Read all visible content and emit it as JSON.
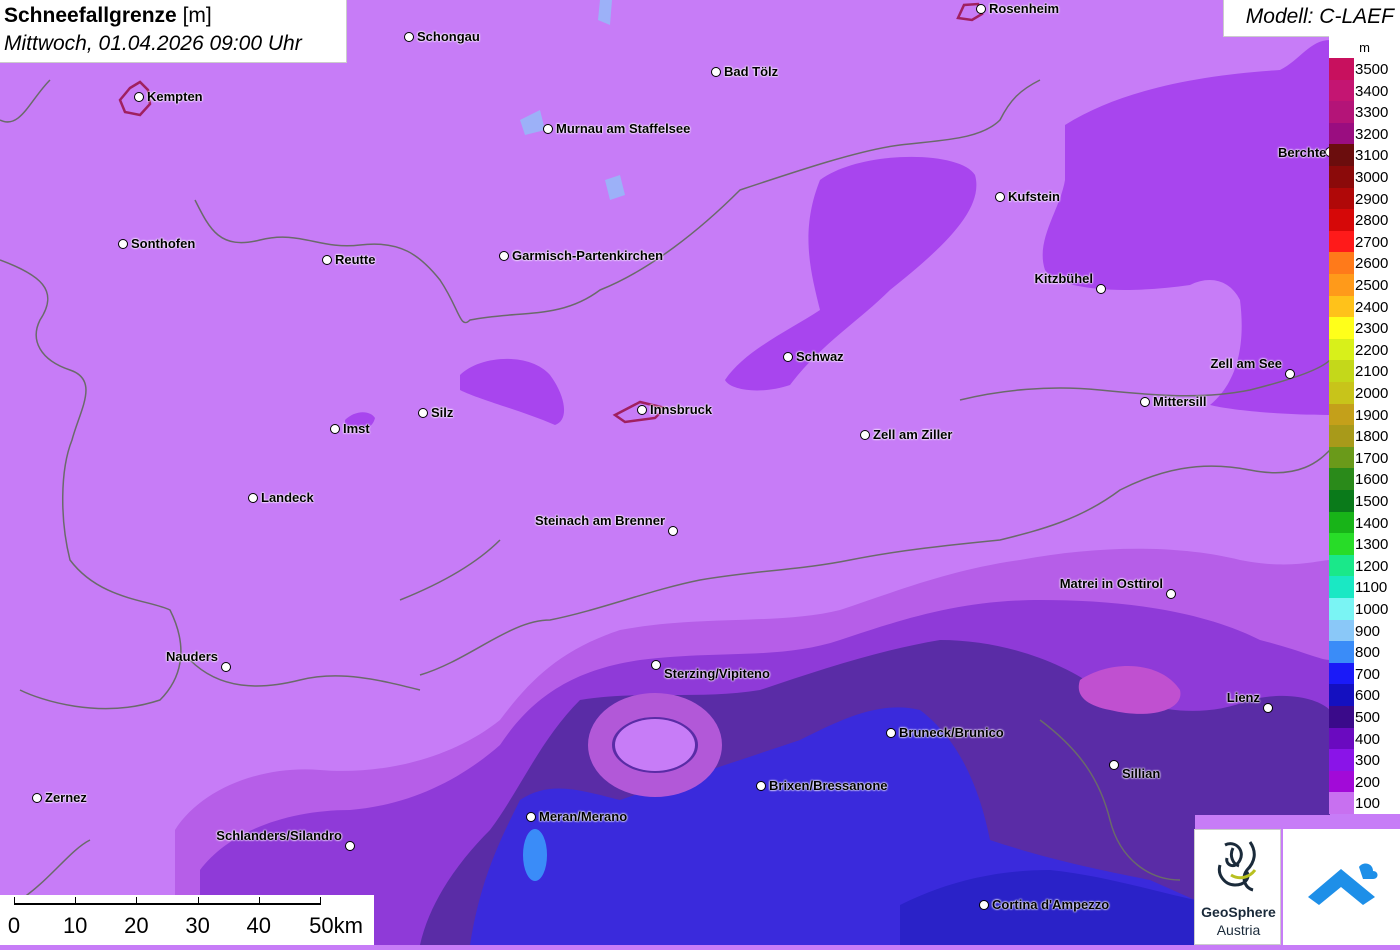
{
  "title": {
    "main": "Schneefallgrenze",
    "unit": "[m]",
    "date": "Mittwoch, 01.04.2026 09:00 Uhr"
  },
  "model_label": "Modell: C-LAEF",
  "legend": {
    "unit": "m",
    "levels": [
      {
        "value": "3500",
        "color": "#c8105e"
      },
      {
        "value": "3400",
        "color": "#c41572"
      },
      {
        "value": "3300",
        "color": "#b41478"
      },
      {
        "value": "3200",
        "color": "#9a0d80"
      },
      {
        "value": "3100",
        "color": "#6b0d0d"
      },
      {
        "value": "3000",
        "color": "#8b0a0a"
      },
      {
        "value": "2900",
        "color": "#b00808"
      },
      {
        "value": "2800",
        "color": "#d60808"
      },
      {
        "value": "2700",
        "color": "#ff1a1a"
      },
      {
        "value": "2600",
        "color": "#ff7a1a"
      },
      {
        "value": "2500",
        "color": "#ff9a1a"
      },
      {
        "value": "2400",
        "color": "#ffc21a"
      },
      {
        "value": "2300",
        "color": "#ffff1a"
      },
      {
        "value": "2200",
        "color": "#d8f01a"
      },
      {
        "value": "2100",
        "color": "#c4d81a"
      },
      {
        "value": "2000",
        "color": "#c8c41a"
      },
      {
        "value": "1900",
        "color": "#c4a01a"
      },
      {
        "value": "1800",
        "color": "#a89a1a"
      },
      {
        "value": "1700",
        "color": "#6a9a1a"
      },
      {
        "value": "1600",
        "color": "#2a8a1a"
      },
      {
        "value": "1500",
        "color": "#0a7a1a"
      },
      {
        "value": "1400",
        "color": "#18b418"
      },
      {
        "value": "1300",
        "color": "#28dc28"
      },
      {
        "value": "1200",
        "color": "#1ae88a"
      },
      {
        "value": "1100",
        "color": "#1ae8c4"
      },
      {
        "value": "1000",
        "color": "#7af4f4"
      },
      {
        "value": "900",
        "color": "#8ac8f8"
      },
      {
        "value": "800",
        "color": "#3a8cf8"
      },
      {
        "value": "700",
        "color": "#1a1af8"
      },
      {
        "value": "600",
        "color": "#1410c0"
      },
      {
        "value": "500",
        "color": "#3a0a8a"
      },
      {
        "value": "400",
        "color": "#6a0ac0"
      },
      {
        "value": "300",
        "color": "#8a14e8"
      },
      {
        "value": "200",
        "color": "#a20ad8"
      },
      {
        "value": "100",
        "color": "#c870f0"
      }
    ]
  },
  "scale_bar": {
    "labels": [
      "0",
      "10",
      "20",
      "30",
      "40",
      "50km"
    ]
  },
  "logos": {
    "geosphere_name": "GeoSphere",
    "geosphere_sub": "Austria"
  },
  "cities": [
    {
      "name": "Rosenheim"
    },
    {
      "name": "Schongau"
    },
    {
      "name": "Kempten"
    },
    {
      "name": "Bad Tölz"
    },
    {
      "name": "Murnau am Staffelsee"
    },
    {
      "name": "Berchte"
    },
    {
      "name": "Kufstein"
    },
    {
      "name": "Sonthofen"
    },
    {
      "name": "Reutte"
    },
    {
      "name": "Garmisch-Partenkirchen"
    },
    {
      "name": "Kitzbühel"
    },
    {
      "name": "Schwaz"
    },
    {
      "name": "Zell am See"
    },
    {
      "name": "Mittersill"
    },
    {
      "name": "Silz"
    },
    {
      "name": "Innsbruck"
    },
    {
      "name": "Imst"
    },
    {
      "name": "Zell am Ziller"
    },
    {
      "name": "Landeck"
    },
    {
      "name": "Steinach am Brenner"
    },
    {
      "name": "Matrei in Osttirol"
    },
    {
      "name": "Nauders"
    },
    {
      "name": "Sterzing/Vipiteno"
    },
    {
      "name": "Lienz"
    },
    {
      "name": "Bruneck/Brunico"
    },
    {
      "name": "Sillian"
    },
    {
      "name": "Brixen/Bressanone"
    },
    {
      "name": "Zernez"
    },
    {
      "name": "Meran/Merano"
    },
    {
      "name": "Schlanders/Silandro"
    },
    {
      "name": "Cortina d'Ampezzo"
    }
  ]
}
